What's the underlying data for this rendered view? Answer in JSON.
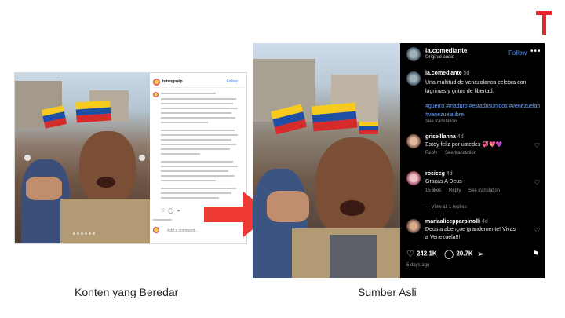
{
  "brand": {
    "logo_name": "tempo-t-logo",
    "color": "#e4262f"
  },
  "left_panel": {
    "caption": "Konten yang Beredar",
    "account": "tutangnelp",
    "follow_label": "Follow",
    "comment_placeholder": "Add a comment...",
    "timestamp": "5 days ago"
  },
  "right_panel": {
    "caption": "Sumber Asli",
    "header": {
      "handle": "ia.comediante",
      "audio": "Original audio",
      "follow_label": "Follow",
      "more": "•••"
    },
    "post": {
      "user": "ia.comediante",
      "time": "5d",
      "text": "Una multitud de venezolanos celebra con lágrimas y gritos de libertad.",
      "hashtags": "#guerra #maduro #estadosunidos #venezuelan #venezuelalibre",
      "see_translation": "See translation"
    },
    "comments": [
      {
        "user": "griselllanna",
        "time": "4d",
        "text": "Estoy feliz por ustedes 💞💖💜",
        "meta": [
          "Reply",
          "See translation"
        ]
      },
      {
        "user": "rosiccg",
        "time": "4d",
        "text": "Graças A Deus",
        "meta": [
          "15 likes",
          "Reply",
          "See translation"
        ]
      },
      {
        "user": "mariaalicepparpinolli",
        "time": "4d",
        "text": "Deus a abençoe grandemente! Vivas a Venezuela!!!",
        "meta": []
      }
    ],
    "view_replies": "View all 1 replies",
    "stats": {
      "likes": "242.1K",
      "comments": "20.7K"
    },
    "ago": "5 days ago"
  },
  "colors": {
    "instagram_bg": "#000000",
    "link_blue": "#4c8cf5",
    "arrow_red": "#ee3a33"
  }
}
